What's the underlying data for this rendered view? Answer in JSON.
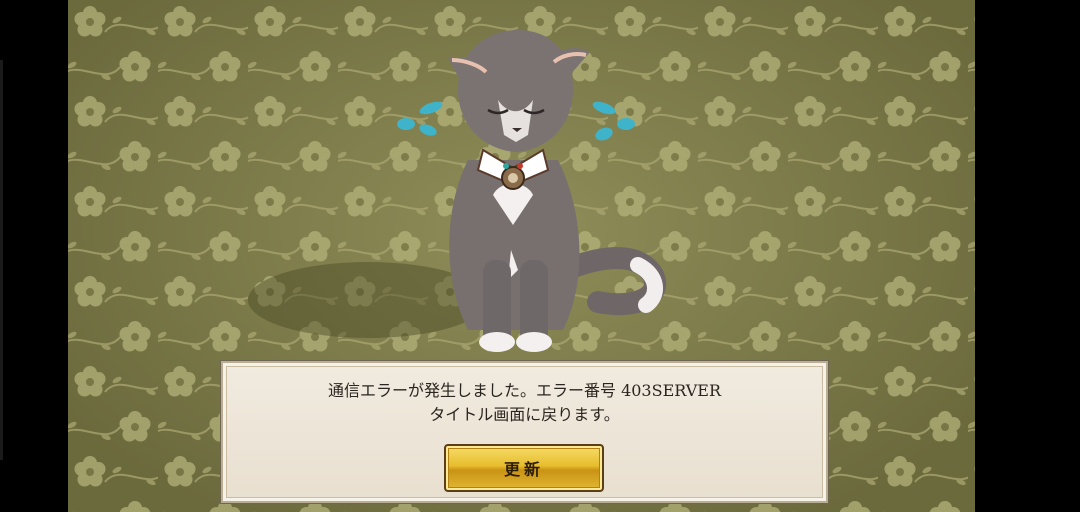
{
  "error_dialog": {
    "message_line1": "通信エラーが発生しました。エラー番号 403SERVER",
    "message_line2": "タイトル画面に戻ります。",
    "refresh_button_label": "更新"
  },
  "colors": {
    "wallpaper": "#8f8d58",
    "dialog_background": "#f1ebe0",
    "button_gold": "#e7bd2d",
    "tear_drops": "#3fb3c9"
  },
  "icons": {
    "character": "sad-cat-icon",
    "tears": "tear-drops-icon"
  }
}
